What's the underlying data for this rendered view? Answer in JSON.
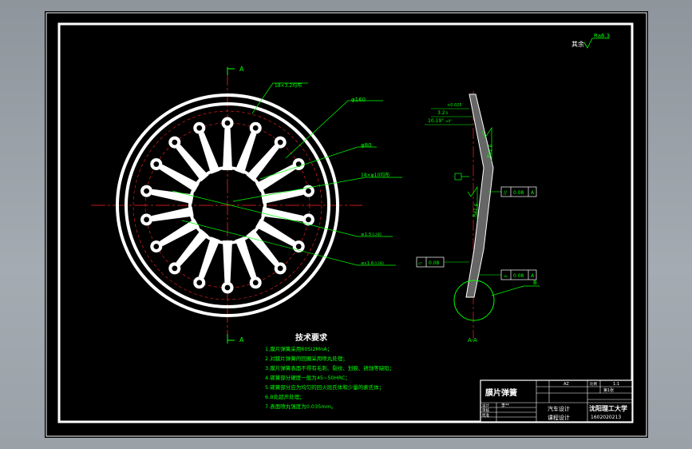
{
  "drawing": {
    "roughness_label": "其余",
    "roughness_value": "Ra6.3",
    "section_marks": [
      "A",
      "A"
    ],
    "section_view_label": "A-A",
    "detail_label": "B"
  },
  "front_view": {
    "dims": {
      "slot": "18×3.2均布",
      "outer_dia": "φ160",
      "inner_dia": "φ80",
      "holes": "18×φ10均布",
      "tol1_base": "≡1.5",
      "tol1_dev": "0.260",
      "tol2_base": "≡ε1.6",
      "tol2_dev": "0.260"
    }
  },
  "section_view": {
    "dims": {
      "top_tol": "+0.025",
      "thickness": "3.2",
      "thickness_dev": "0",
      "angle": "10.19°",
      "angle_dev": "±0°"
    },
    "ra_labels": [
      "Ra1.6",
      "Ra1.6"
    ],
    "gd_parallel": {
      "symbol": "//",
      "value": "0.08",
      "datum": "A"
    },
    "gd_flatness": {
      "symbol": "▱",
      "value": "0.08"
    },
    "gd_profile": {
      "symbol": "⌓",
      "value": "0.08",
      "datum": "A"
    }
  },
  "technical_requirements": {
    "title": "技术要求",
    "items": [
      "1.膜片弹簧采用60Si2MnA；",
      "2.对膜片弹簧的回圈采用喷丸处理；",
      "3.膜片弹簧表面不得有毛刺、裂纹、划痕、锈蚀等缺陷；",
      "4.碟簧部分硬度一般为45~50HRC；",
      "5.碟簧部分应为均匀的回火屈氏体和少量的索氏体；",
      "6.B处超声处理；",
      "7.表面喷丸强度为0.035mm。"
    ]
  },
  "title_block": {
    "part_name": "膜片弹簧",
    "material": "AZ",
    "scale": "1:1",
    "sheet_label": "比例",
    "sheet_value": "第1张",
    "course": "汽车设计",
    "design_type": "课程设计",
    "university": "沈阳理工大学",
    "drawing_number": "1602020213",
    "row_labels": [
      "设计",
      "审核",
      "批准"
    ],
    "designer": "李**"
  }
}
